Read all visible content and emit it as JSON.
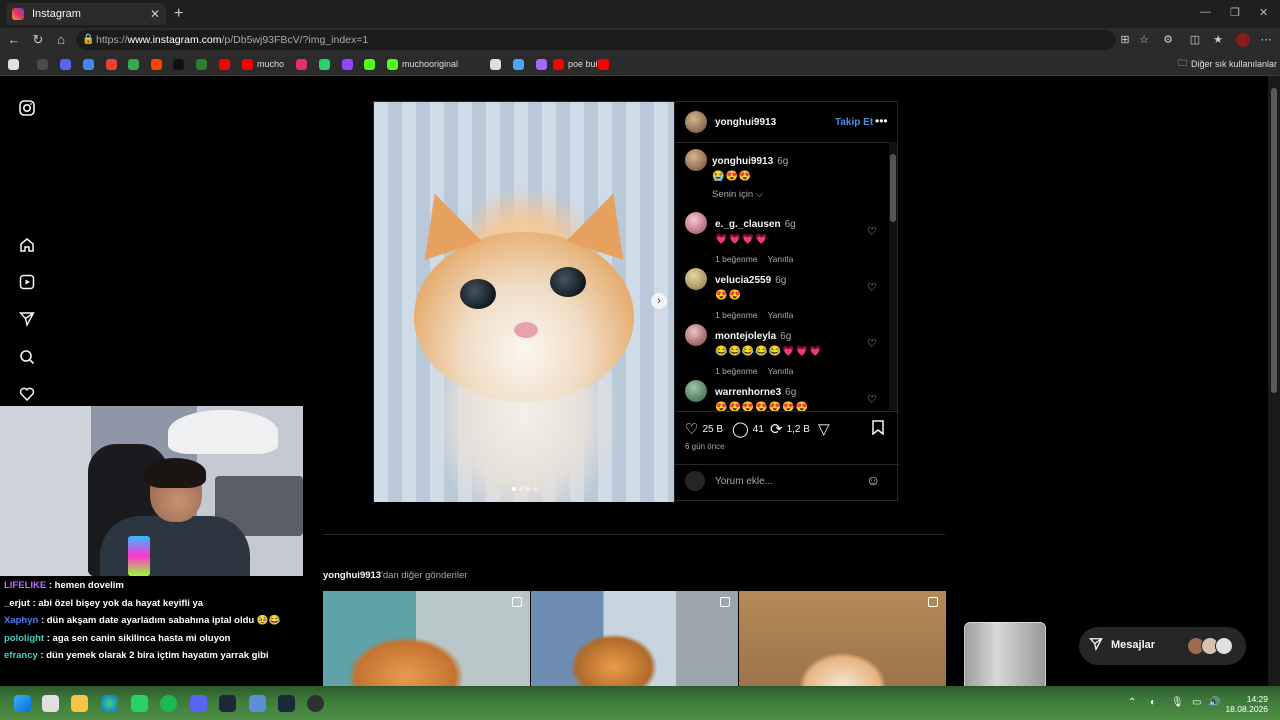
{
  "browser": {
    "tab_title": "Instagram",
    "url_prefix": "https://",
    "url_host": "www.instagram.com",
    "url_path": "/p/Db5wj93FBcV/?img_index=1",
    "bookmarks": [
      {
        "label": "",
        "color": "#e0e0e0"
      },
      {
        "label": "",
        "color": "#4a4a4a"
      },
      {
        "label": "",
        "color": "#5865f2"
      },
      {
        "label": "",
        "color": "#4285f4"
      },
      {
        "label": "",
        "color": "#ea4335"
      },
      {
        "label": "",
        "color": "#34a853"
      },
      {
        "label": "",
        "color": "#ff4500"
      },
      {
        "label": "",
        "color": "#111111"
      },
      {
        "label": "",
        "color": "#2e7d32"
      },
      {
        "label": "",
        "color": "#ff0000"
      },
      {
        "label": "mucho",
        "color": "#ff0000"
      },
      {
        "label": "",
        "color": "#e1306c"
      },
      {
        "label": "",
        "color": "#25d366"
      },
      {
        "label": "",
        "color": "#9146ff"
      },
      {
        "label": "",
        "color": "#53fc18"
      },
      {
        "label": "muchooriginal",
        "color": "#53fc18"
      },
      {
        "label": "",
        "color": "#dddddd"
      },
      {
        "label": "",
        "color": "#4aa3ff"
      },
      {
        "label": "",
        "color": "#a26bfa"
      },
      {
        "label": "poe build",
        "color": "#ff0000"
      },
      {
        "label": "",
        "color": "#ff0000"
      }
    ],
    "other_bookmarks": "Diğer sık kullanılanlar"
  },
  "post": {
    "author": "yonghui9913",
    "follow_label": "Takip Et",
    "caption_time": "6g",
    "caption_emoji": "😭😍😍",
    "for_you": "Senin için ⌵",
    "comments": [
      {
        "user": "e._g._clausen",
        "time": "6g",
        "text": "💗💗💗💗",
        "likes": "1 beğenme",
        "reply": "Yanıtla"
      },
      {
        "user": "velucia2559",
        "time": "6g",
        "text": "😍😍",
        "likes": "1 beğenme",
        "reply": "Yanıtla"
      },
      {
        "user": "montejoleyla",
        "time": "6g",
        "text": "😂😂😂😂😂💗💗💗",
        "likes": "1 beğenme",
        "reply": "Yanıtla"
      },
      {
        "user": "warrenhorne3",
        "time": "6g",
        "text": "😍😍😍😍😍😍😍",
        "likes": "",
        "reply": ""
      }
    ],
    "likes_count": "25 B",
    "comments_count": "41",
    "reposts_count": "1,2 B",
    "posted_ago": "6 gün önce",
    "add_comment_placeholder": "Yorum ekle..."
  },
  "more_posts": {
    "user": "yonghui9913",
    "suffix": "'dan diğer gönderiler"
  },
  "messages_label": "Mesajlar",
  "chat": [
    {
      "user": "LIFELIKE",
      "color": "#b86bff",
      "text": " : hemen dovelim"
    },
    {
      "user": "_erjut",
      "color": "#ffffff",
      "text": " : abi özel bişey yok da hayat keyifli ya"
    },
    {
      "user": "Xaphyn",
      "color": "#4a7dff",
      "text": " : dün akşam date ayarladım sabahına iptal oldu 🥹😂"
    },
    {
      "user": "pololight",
      "color": "#3fd1c0",
      "text": " : aga sen canin sikilinca hasta mi oluyon"
    },
    {
      "user": "efrancy",
      "color": "#3fd1c0",
      "text": " : dün yemek olarak 2 bira içtim hayatım yarrak gibi"
    }
  ],
  "clock": {
    "time": "14:29",
    "date": "18.08.2026"
  }
}
